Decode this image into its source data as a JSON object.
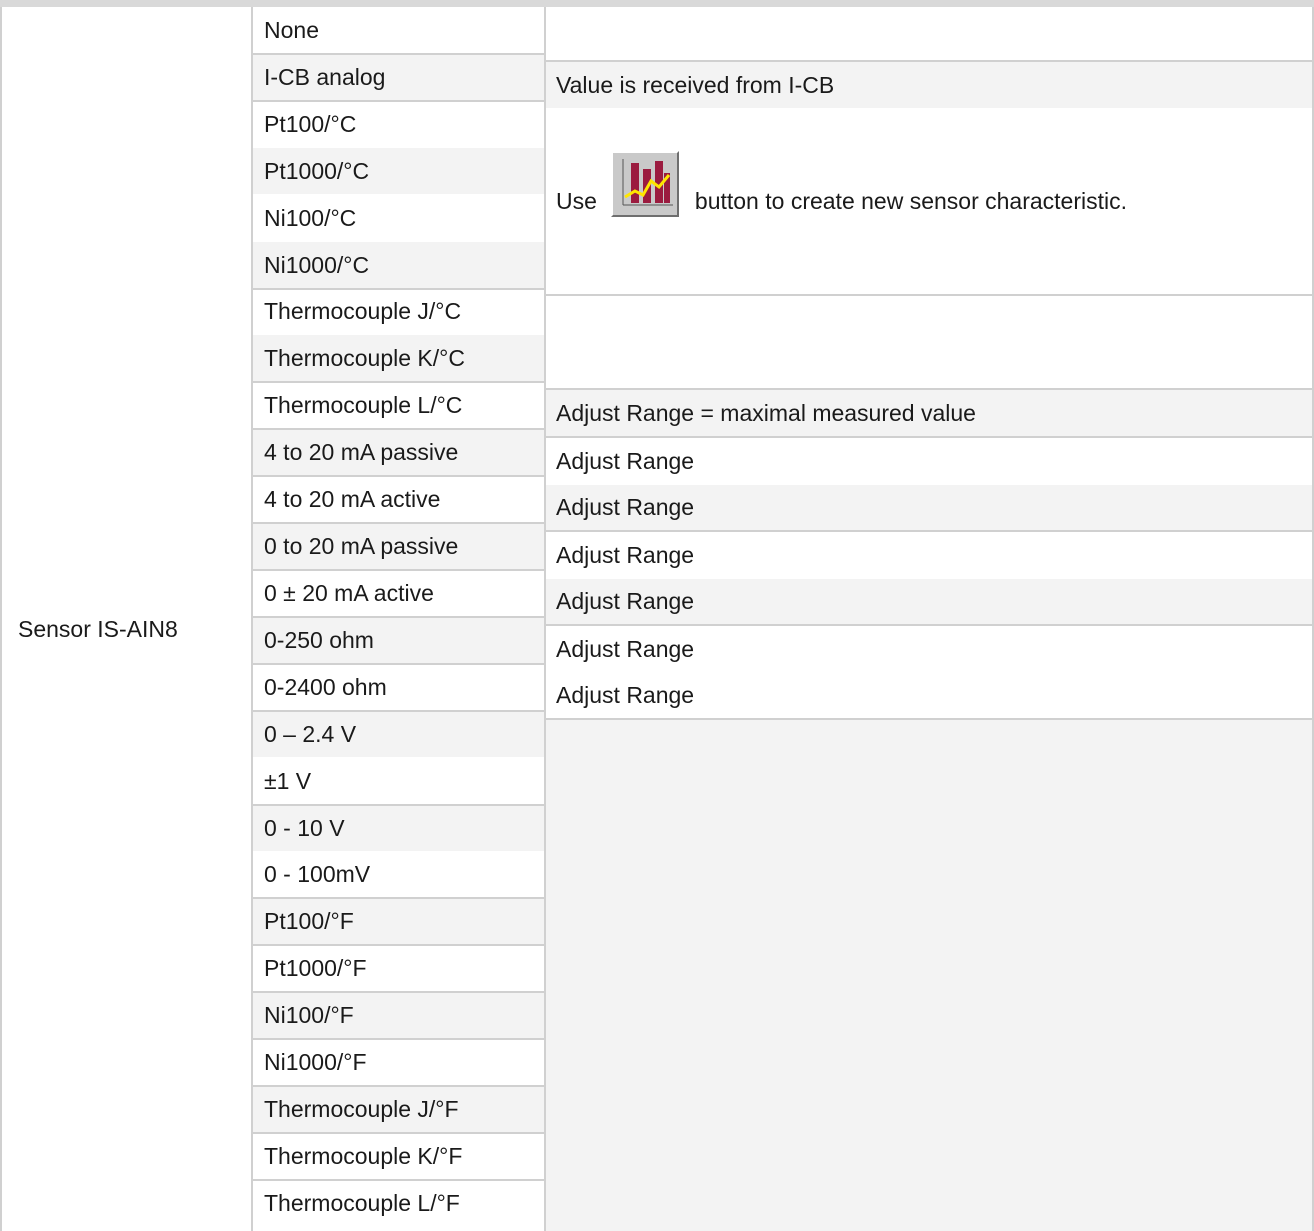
{
  "sensor_label": "Sensor IS-AIN8",
  "rows": [
    {
      "option": "None",
      "description": ""
    },
    {
      "option": "I-CB analog",
      "description": "Value is received from I-CB"
    },
    {
      "option": "Pt100/°C"
    },
    {
      "option": "Pt1000/°C"
    },
    {
      "option": "Ni100/°C"
    },
    {
      "option": "Ni1000/°C"
    },
    {
      "option": "Thermocouple J/°C"
    },
    {
      "option": "Thermocouple K/°C"
    },
    {
      "option": "Thermocouple L/°C",
      "description": "Adjust Range = maximal measured value"
    },
    {
      "option": "4 to 20 mA passive",
      "description": "Adjust Range"
    },
    {
      "option": "4 to 20 mA active",
      "description": "Adjust Range"
    },
    {
      "option": "0 to 20 mA passive",
      "description": "Adjust Range"
    },
    {
      "option": "0 ± 20 mA active",
      "description": "Adjust Range"
    },
    {
      "option": "0-250 ohm",
      "description": "Adjust Range"
    },
    {
      "option": "0-2400 ohm",
      "description": "Adjust Range"
    },
    {
      "option": "0 – 2.4 V"
    },
    {
      "option": "±1 V"
    },
    {
      "option": "0 - 10 V"
    },
    {
      "option": "0 - 100mV"
    },
    {
      "option": "Pt100/°F"
    },
    {
      "option": "Pt1000/°F"
    },
    {
      "option": "Ni100/°F"
    },
    {
      "option": "Ni1000/°F"
    },
    {
      "option": "Thermocouple J/°F"
    },
    {
      "option": "Thermocouple K/°F"
    },
    {
      "option": "Thermocouple L/°F"
    }
  ],
  "characteristic_note": {
    "prefix": "Use",
    "suffix": "button to create new sensor characteristic.",
    "icon": "sensor-characteristic-chart-icon"
  },
  "colors": {
    "shade": "#f3f3f3",
    "border": "#d0d0d0",
    "chart_bars": "#9b1b3f",
    "chart_line": "#ffe600"
  }
}
